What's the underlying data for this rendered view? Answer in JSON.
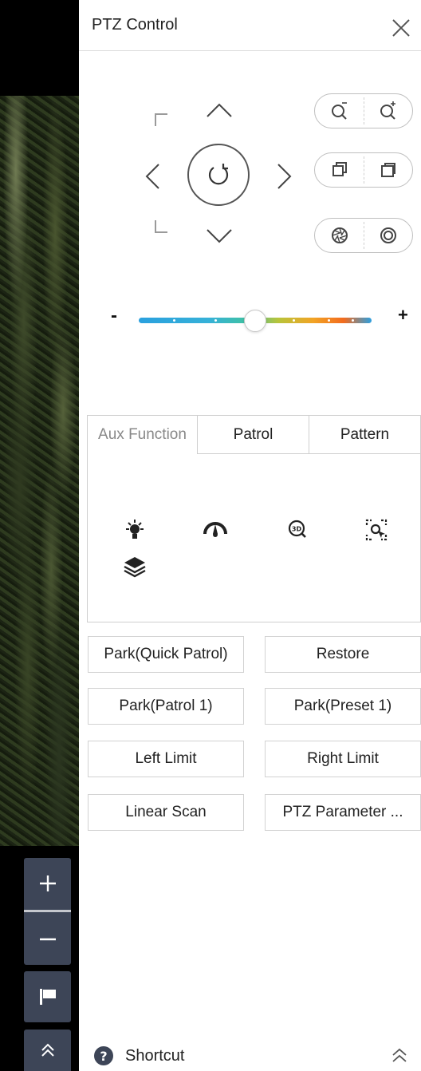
{
  "panel": {
    "title": "PTZ Control"
  },
  "tabs": [
    {
      "label": "Aux Function",
      "active": true
    },
    {
      "label": "Patrol",
      "active": false
    },
    {
      "label": "Pattern",
      "active": false
    }
  ],
  "aux_icons": [
    "light-icon",
    "wiper-icon",
    "3d-zoom-icon",
    "auto-focus-icon",
    "layers-icon"
  ],
  "buttons": {
    "park_quick_patrol": "Park(Quick Patrol)",
    "restore": "Restore",
    "park_patrol_1": "Park(Patrol 1)",
    "park_preset_1": "Park(Preset 1)",
    "left_limit": "Left Limit",
    "right_limit": "Right Limit",
    "linear_scan": "Linear Scan",
    "ptz_parameter": "PTZ Parameter ..."
  },
  "speed": {
    "minus": "-",
    "plus": "+",
    "level_fraction": 0.5
  },
  "footer": {
    "shortcut_label": "Shortcut"
  },
  "colors": {
    "accent": "#2c9fe0",
    "video_controls_bg": "#3d4557",
    "help_icon": "#3d4557"
  }
}
